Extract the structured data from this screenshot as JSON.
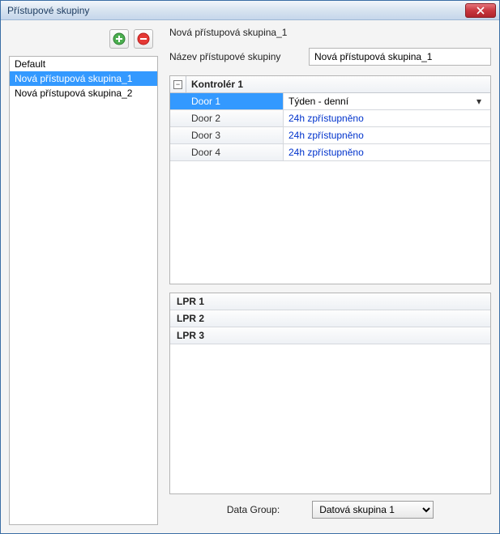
{
  "window": {
    "title": "Přístupové skupiny"
  },
  "groups": {
    "items": [
      {
        "label": "Default",
        "selected": false
      },
      {
        "label": "Nová přístupová skupina_1",
        "selected": true
      },
      {
        "label": "Nová přístupová skupina_2",
        "selected": false
      }
    ]
  },
  "detail": {
    "heading": "Nová přístupová skupina_1",
    "name_label": "Název přístupové skupiny",
    "name_value": "Nová přístupová skupina_1"
  },
  "controller": {
    "header": "Kontrolér 1",
    "expand_symbol": "−",
    "rows": [
      {
        "door": "Door 1",
        "schedule": "Týden - denní",
        "selected": true,
        "dropdown": true
      },
      {
        "door": "Door 2",
        "schedule": "24h zpřístupněno",
        "selected": false,
        "dropdown": false
      },
      {
        "door": "Door 3",
        "schedule": "24h zpřístupněno",
        "selected": false,
        "dropdown": false
      },
      {
        "door": "Door 4",
        "schedule": "24h zpřístupněno",
        "selected": false,
        "dropdown": false
      }
    ]
  },
  "lpr": {
    "items": [
      {
        "label": "LPR 1"
      },
      {
        "label": "LPR 2"
      },
      {
        "label": "LPR 3"
      }
    ]
  },
  "footer": {
    "label": "Data Group:",
    "selected": "Datová skupina 1"
  },
  "icons": {
    "add": "add-icon",
    "remove": "remove-icon",
    "close": "close-icon",
    "dropdown": "chevron-down-icon"
  }
}
